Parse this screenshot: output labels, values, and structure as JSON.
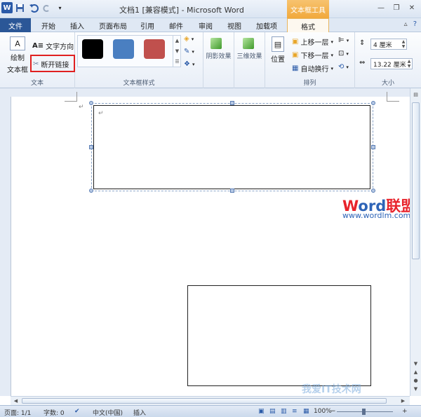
{
  "titlebar": {
    "title": "文档1 [兼容模式] - Microsoft Word",
    "contextual_group": "文本框工具",
    "logo": "W"
  },
  "tabs": {
    "file": "文件",
    "home": "开始",
    "insert": "插入",
    "layout": "页面布局",
    "references": "引用",
    "mailings": "邮件",
    "review": "审阅",
    "view": "视图",
    "addins": "加载项",
    "format": "格式"
  },
  "ribbon": {
    "text_group": {
      "label": "文本",
      "draw_textbox": "绘制",
      "draw_textbox_2": "文本框",
      "text_direction": "文字方向",
      "break_link": "断开链接"
    },
    "styles_group": {
      "label": "文本框样式",
      "swatch_colors": [
        "#000000",
        "#4a7fc1",
        "#c0504d"
      ]
    },
    "shadow_group": {
      "label": "阴影效果"
    },
    "threed_group": {
      "label": "三维效果"
    },
    "arrange_group": {
      "label": "排列",
      "position": "位置",
      "bring_forward": "上移一层",
      "send_backward": "下移一层",
      "wrap_text": "自动换行"
    },
    "size_group": {
      "label": "大小",
      "height": "4 厘米",
      "width": "13.22 厘米"
    }
  },
  "watermark": {
    "brand_w": "W",
    "brand_ord": "ord",
    "brand_cn": "联盟",
    "url": "www.wordlm.com",
    "corner": "我爱IT技术网"
  },
  "paragraph_mark": "↵",
  "statusbar": {
    "page": "页面: 1/1",
    "words": "字数: 0",
    "language": "中文(中国)",
    "mode": "插入",
    "zoom": "100%"
  },
  "colors": {
    "file_tab": "#2b5797",
    "contextual": "#f1a93b",
    "highlight_box": "#e02020"
  }
}
